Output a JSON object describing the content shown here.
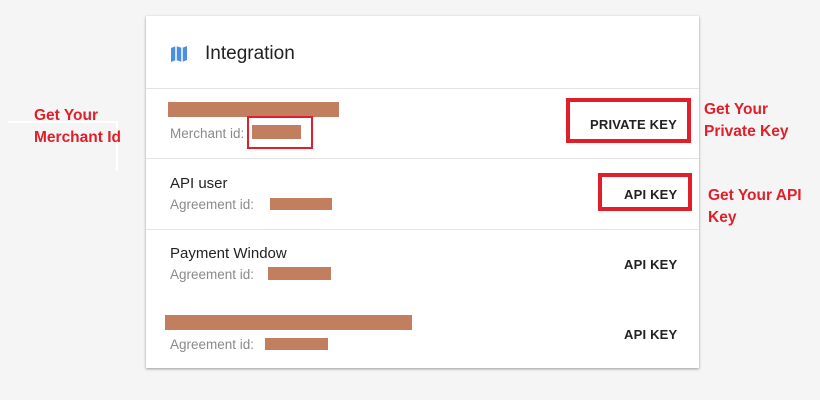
{
  "card": {
    "title": "Integration",
    "icon": "map-icon",
    "rows": [
      {
        "title": "",
        "sub_label": "Merchant id:",
        "button": "PRIVATE KEY"
      },
      {
        "title": "API user",
        "sub_label": "Agreement id:",
        "button": "API KEY"
      },
      {
        "title": "Payment Window",
        "sub_label": "Agreement id:",
        "button": "API KEY"
      },
      {
        "title": "",
        "sub_label": "Agreement id:",
        "button": "API KEY"
      }
    ]
  },
  "annotations": {
    "merchant_id": [
      "Get Your",
      "Merchant Id"
    ],
    "private_key": [
      "Get Your",
      "Private Key"
    ],
    "api_key": [
      "Get Your API",
      "Key"
    ]
  },
  "colors": {
    "highlight": "#e01f2a",
    "redaction": "#c27f60",
    "icon": "#4a90e2"
  }
}
